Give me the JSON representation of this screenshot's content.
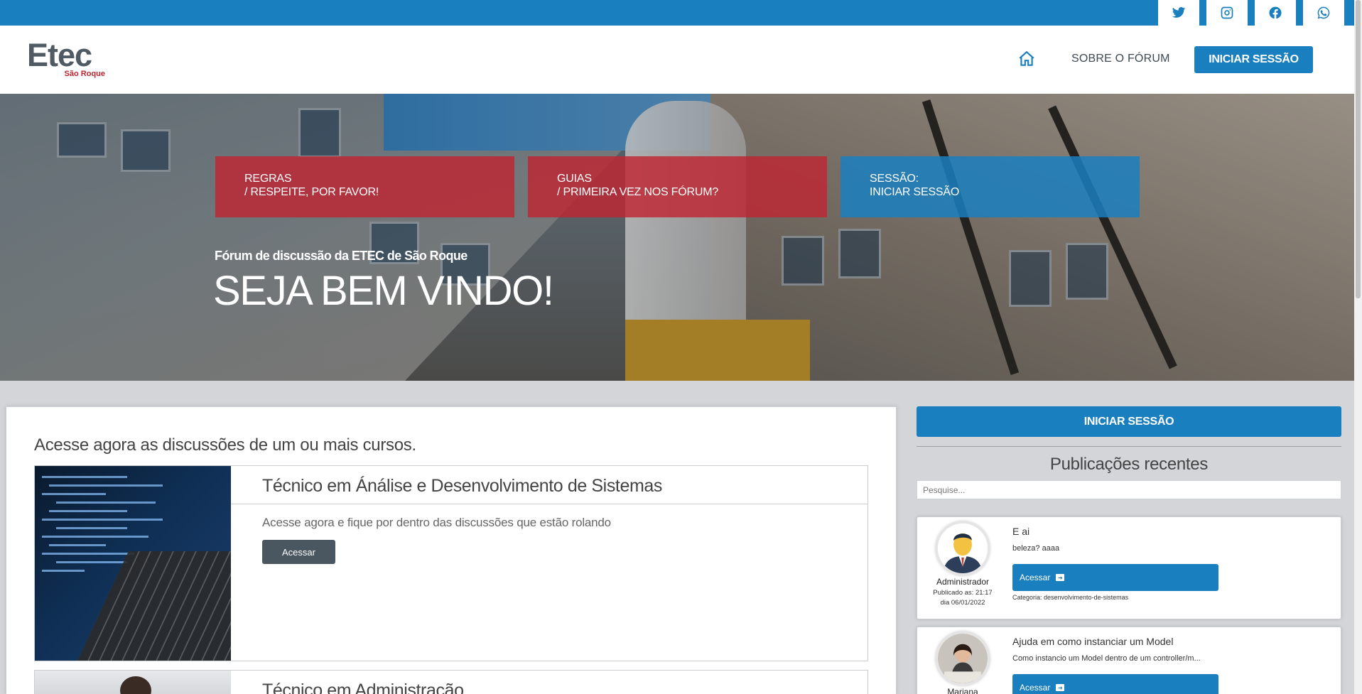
{
  "social": [
    "twitter-icon",
    "instagram-icon",
    "facebook-icon",
    "whatsapp-icon"
  ],
  "header": {
    "logo_main": "Etec",
    "logo_sub": "São Roque",
    "about": "SOBRE O FÓRUM",
    "login": "INICIAR SESSÃO"
  },
  "hero": {
    "tiles": [
      {
        "line1": "REGRAS",
        "line2": "/ RESPEITE, POR FAVOR!"
      },
      {
        "line1": "GUIAS",
        "line2": "/ PRIMEIRA VEZ NOS FÓRUM?"
      },
      {
        "line1": "SESSÃO:",
        "line2": "INICIAR SESSÃO"
      }
    ],
    "subtitle": "Fórum de discussão da ETEC de São Roque",
    "title": "SEJA BEM VINDO!"
  },
  "main": {
    "heading": "Acesse agora as discussões de um ou mais cursos.",
    "courses": [
      {
        "title": "Técnico em Ánálise e Desenvolvimento de Sistemas",
        "description": "Acesse agora e fique por dentro das discussões que estão rolando",
        "button": "Acessar"
      },
      {
        "title": "Técnico em Administração"
      }
    ]
  },
  "sidebar": {
    "login": "INICIAR SESSÃO",
    "recent_title": "Publicações recentes",
    "search_placeholder": "Pesquise...",
    "posts": [
      {
        "author": "Administrador",
        "published_time": "Publicado as: 21:17",
        "published_date": "dia 06/01/2022",
        "title": "E ai",
        "body": "beleza? aaaa",
        "button": "Acessar",
        "category": "Categoria: desenvolvimento-de-sistemas"
      },
      {
        "author": "Mariana",
        "title": "Ajuda em como instanciar um Model",
        "body": "Como instancio um Model dentro de um controller/m...",
        "button": "Acessar"
      }
    ]
  },
  "colors": {
    "primary": "#1a7fbf",
    "accent_red": "#be2632",
    "dark_button": "#4a5761"
  }
}
